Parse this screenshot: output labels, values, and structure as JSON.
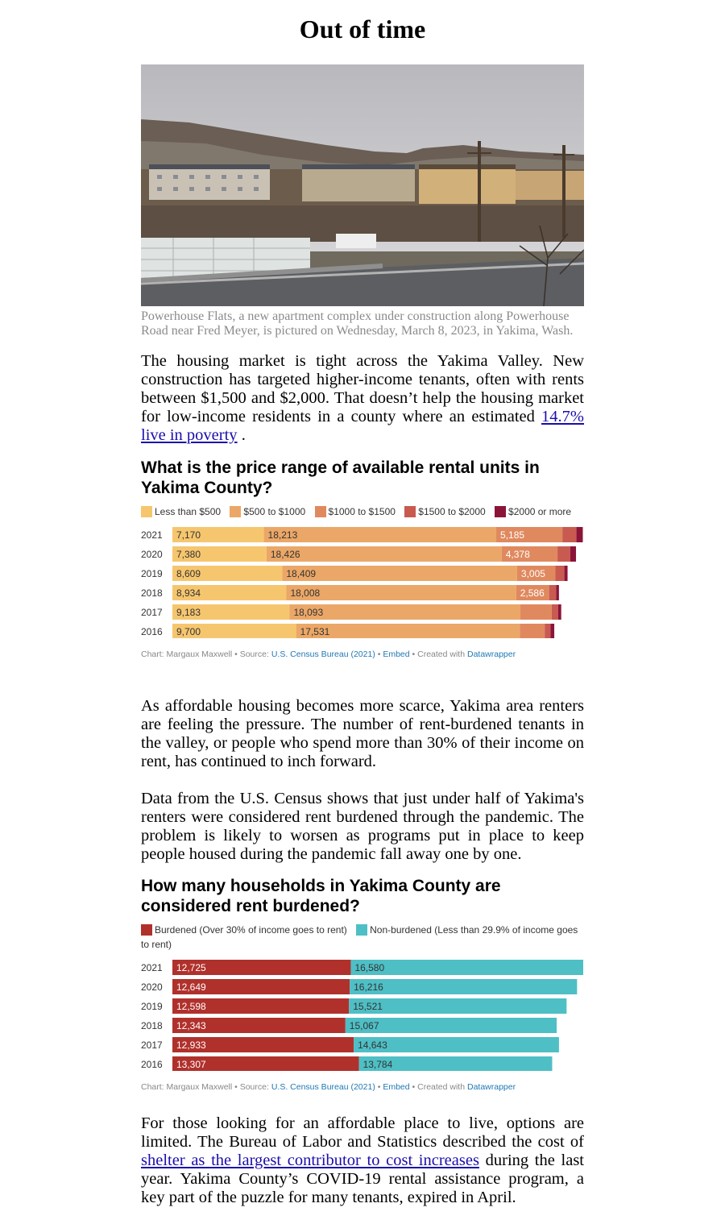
{
  "article": {
    "title": "Out of time",
    "photo_caption": "Powerhouse Flats, a new apartment complex under construction along Powerhouse Road near Fred Meyer, is pictured on Wednesday, March 8, 2023, in Yakima, Wash.",
    "p1_text": "The housing market is tight across the Yakima Valley. New construction has targeted higher-income tenants, often with rents between $1,500 and $2,000. That doesn’t help the housing market for low-income residents in a county where an estimated ",
    "p1_link": "14.7% live in poverty",
    "p1_end": " .",
    "p2": "As affordable housing becomes more scarce, Yakima area renters are feeling the pressure. The number of rent-burdened tenants in the valley, or people who spend more than 30% of their income on rent, has continued to inch forward.",
    "p3": "Data from the U.S. Census shows that just under half of Yakima's renters were considered rent burdened through the pandemic. The problem is likely to worsen as programs put in place to keep people housed during the pandemic fall away one by one.",
    "p4_text": "For those looking for an affordable place to live, options are limited. The Bureau of Labor and Statistics described the cost of ",
    "p4_link": "shelter as the largest contributor to cost increases",
    "p4_end": " during the last year. Yakima County’s COVID-19 rental assistance program, a key part of the puzzle for many tenants, expired in April."
  },
  "footer": {
    "credit": "Chart: Margaux Maxwell • Source: ",
    "source_link": "U.S. Census Bureau (2021)",
    "sep1": " • ",
    "embed": "Embed",
    "created": " • Created with ",
    "tool": "Datawrapper"
  },
  "chart_data": [
    {
      "type": "bar",
      "orientation": "horizontal-stacked",
      "title": "What is the price range of available rental units in Yakima County?",
      "categories": [
        "2021",
        "2020",
        "2019",
        "2018",
        "2017",
        "2016"
      ],
      "series": [
        {
          "name": "Less than $500",
          "color": "#f6c66e",
          "values": [
            7170,
            7380,
            8609,
            8934,
            9183,
            9700
          ],
          "labels": [
            "7,170",
            "7,380",
            "8,609",
            "8,934",
            "9,183",
            "9,700"
          ]
        },
        {
          "name": "$500 to $1000",
          "color": "#eba767",
          "values": [
            18213,
            18426,
            18409,
            18008,
            18093,
            17531
          ],
          "labels": [
            "18,213",
            "18,426",
            "18,409",
            "18,008",
            "18,093",
            "17,531"
          ]
        },
        {
          "name": "$1000 to $1500",
          "color": "#e0895f",
          "values": [
            5185,
            4378,
            3005,
            2586,
            2450,
            1950
          ],
          "labels": [
            "5,185",
            "4,378",
            "3,005",
            "2,586",
            "",
            ""
          ]
        },
        {
          "name": "$1500 to $2000",
          "color": "#c85a50",
          "values": [
            1100,
            1000,
            700,
            550,
            500,
            450
          ],
          "labels": [
            "",
            "",
            "",
            "",
            "",
            ""
          ]
        },
        {
          "name": "$2000 or more",
          "color": "#8b1538",
          "values": [
            500,
            450,
            250,
            220,
            250,
            300
          ],
          "labels": [
            "",
            "",
            "",
            "",
            "",
            ""
          ]
        }
      ],
      "xlim": [
        0,
        32200
      ]
    },
    {
      "type": "bar",
      "orientation": "horizontal-stacked",
      "title": "How many households in Yakima County are considered rent burdened?",
      "categories": [
        "2021",
        "2020",
        "2019",
        "2018",
        "2017",
        "2016"
      ],
      "series": [
        {
          "name": "Burdened (Over 30% of income goes to rent)",
          "color": "#b0312c",
          "values": [
            12725,
            12649,
            12598,
            12343,
            12933,
            13307
          ],
          "labels": [
            "12,725",
            "12,649",
            "12,598",
            "12,343",
            "12,933",
            "13,307"
          ]
        },
        {
          "name": "Non-burdened (Less than 29.9% of income goes to rent)",
          "color": "#4ebfc5",
          "values": [
            16580,
            16216,
            15521,
            15067,
            14643,
            13784
          ],
          "labels": [
            "16,580",
            "16,216",
            "15,521",
            "15,067",
            "14,643",
            "13,784"
          ]
        }
      ],
      "xlim": [
        0,
        29305
      ]
    }
  ]
}
